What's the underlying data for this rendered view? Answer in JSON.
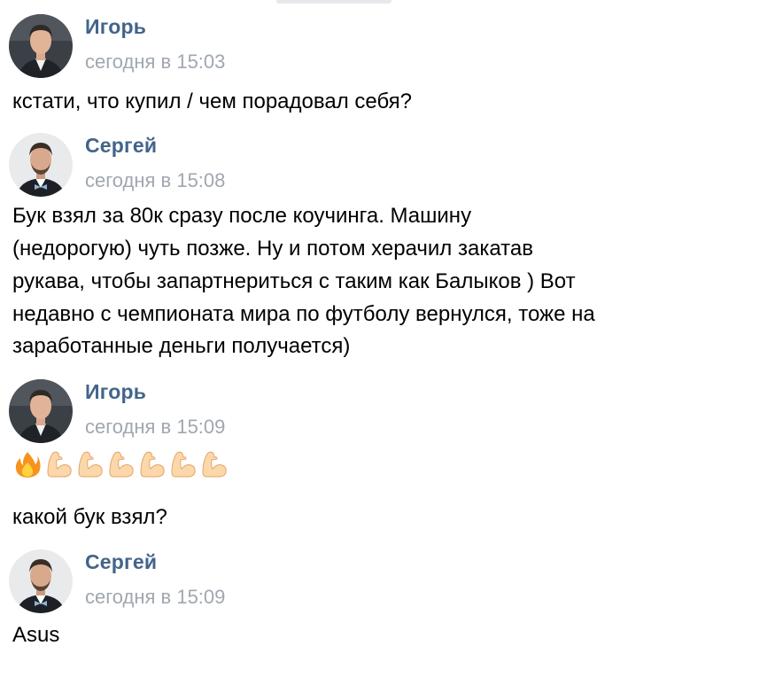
{
  "messages": [
    {
      "author": "Игорь",
      "time": "сегодня в 15:03",
      "lines": [
        "кстати, что купил / чем порадовал себя?"
      ]
    },
    {
      "author": "Сергей",
      "time": "сегодня в 15:08",
      "lines": [
        "Бук взял за 80к сразу после коучинга. Машину",
        "(недорогую) чуть позже. Ну и потом херачил закатав",
        "рукава, чтобы запартнериться с таким как Балыков ) Вот",
        "недавно с чемпионата мира по футболу вернулся, тоже на",
        "заработанные деньги получается)"
      ]
    },
    {
      "author": "Игорь",
      "time": "сегодня в 15:09",
      "emoji": [
        "fire-emoji",
        "flexed-biceps-emoji",
        "flexed-biceps-emoji",
        "flexed-biceps-emoji",
        "flexed-biceps-emoji",
        "flexed-biceps-emoji",
        "flexed-biceps-emoji"
      ],
      "lines": [
        "какой бук взял?"
      ]
    },
    {
      "author": "Сергей",
      "time": "сегодня в 15:09",
      "lines": [
        "Asus"
      ]
    }
  ],
  "colors": {
    "author": "#42648b",
    "time": "#a0a7b0",
    "text": "#000000"
  }
}
